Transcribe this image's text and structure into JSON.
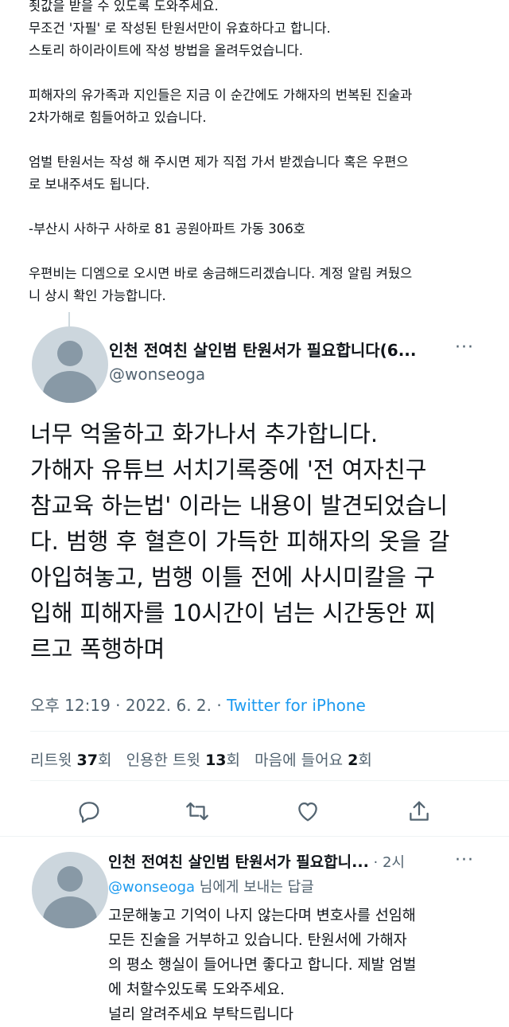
{
  "top_text": {
    "lines": [
      "죗값을 받을 수 있도록 도와주세요.",
      "무조건 '자필' 로 작성된 탄원서만이 유효하다고 합니다.",
      "스토리 하이라이트에 작성 방법을 올려두었습니다."
    ],
    "para2": [
      "피해자의 유가족과 지인들은 지금 이 순간에도 가해자의 번복된 진술과",
      "2차가해로 힘들어하고 있습니다."
    ],
    "para3": [
      "엄벌 탄원서는 작성 해 주시면 제가 직접 가서 받겠습니다 혹은 우편으",
      "로 보내주셔도 됩니다."
    ],
    "para4": [
      "-부산시 사하구 사하로 81 공원아파트 가동 306호"
    ],
    "para5": [
      "우편비는 디엠으로 오시면 바로 송금해드리겠습니다. 계정 알림 켜뒀으",
      "니 상시 확인 가능합니다."
    ]
  },
  "main_tweet": {
    "name": "인천 전여친 살인범 탄원서가 필요합니다(6...",
    "handle": "@wonseoga",
    "more_label": "···",
    "body": [
      "너무 억울하고 화가나서 추가합니다.",
      "가해자 유튜브 서치기록중에 '전 여자친구",
      "참교육 하는법' 이라는 내용이 발견되었습니",
      "다. 범행 후 혈흔이 가득한 피해자의 옷을 갈",
      "아입혀놓고, 범행 이틀 전에 사시미칼을 구",
      "입해 피해자를 10시간이 넘는 시간동안 찌",
      "르고 폭행하며"
    ],
    "time": "오후 12:19",
    "date": "2022. 6. 2.",
    "source": "Twitter for iPhone",
    "sep": " · ",
    "stats": {
      "retweets_label": "리트윗",
      "retweets": "37",
      "quotes_label": "인용한 트윗",
      "quotes": "13",
      "likes_label": "마음에 들어요",
      "likes": "2",
      "unit": "회"
    },
    "actions": [
      "reply-icon",
      "retweet-icon",
      "like-icon",
      "share-icon"
    ]
  },
  "reply": {
    "name": "인천 전여친 살인범 탄원서가 필요합니...",
    "time": "2시",
    "sep": " · ",
    "to_handle": "@wonseoga",
    "to_suffix": " 님에게 보내는 답글",
    "body": [
      "고문해놓고 기억이 나지 않는다며 변호사를 선임해",
      "모든 진술을 거부하고 있습니다. 탄원서에 가해자",
      "의 평소 행실이 들어나면 좋다고 합니다. 제발 엄벌",
      "에 처할수있도록 도와주세요.",
      "널리 알려주세요 부탁드립니다"
    ]
  },
  "colors": {
    "accent": "#1d9bf0",
    "secondary": "#536471",
    "text": "#0f1419"
  }
}
